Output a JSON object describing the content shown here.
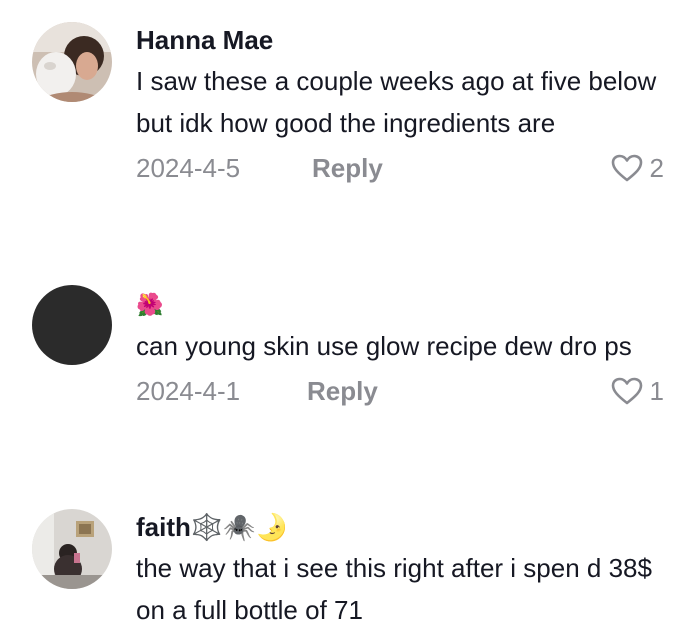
{
  "comments": [
    {
      "username": "Hanna Mae",
      "text": "I saw these a couple weeks ago at five below but idk how good the ingredients are",
      "date": "2024-4-5",
      "reply_label": "Reply",
      "likes": "2"
    },
    {
      "username": "🌺",
      "text": "can young skin use glow recipe dew dro ps",
      "date": "2024-4-1",
      "reply_label": "Reply",
      "likes": "1"
    },
    {
      "username": "faith🕸️🕷️🌛",
      "text": "the way that i see this right after i spen d 38$ on a full bottle of 71"
    }
  ],
  "colors": {
    "text_primary": "#161823",
    "text_secondary": "#8a8b91",
    "avatar_dark": "#2b2b2b"
  }
}
